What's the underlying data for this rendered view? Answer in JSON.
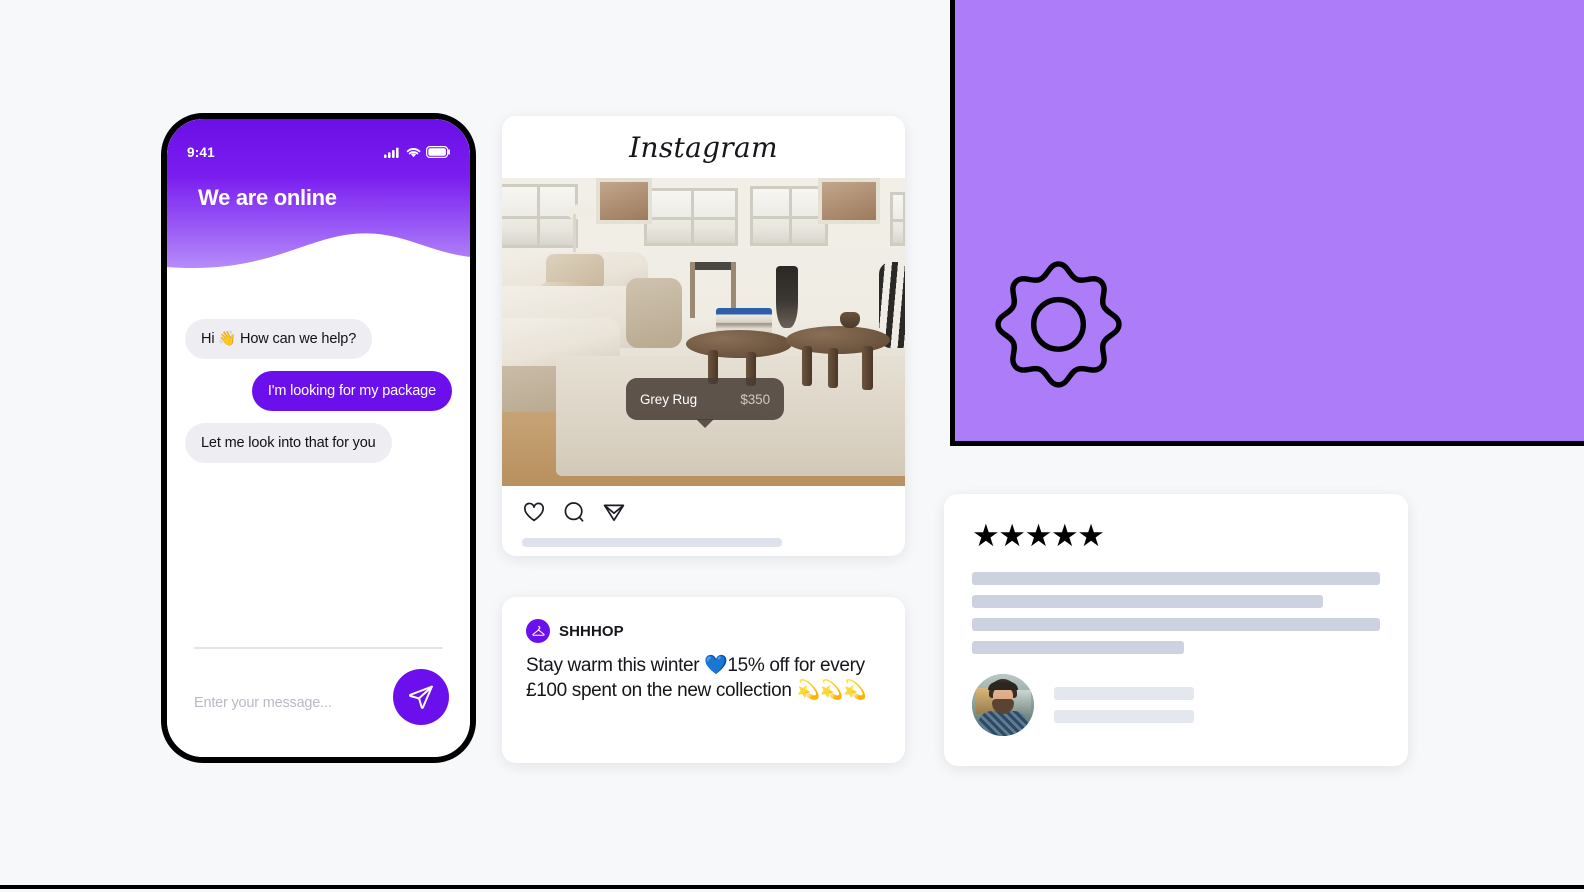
{
  "page": {
    "background_color": "#f6f8fa",
    "accent_purple": "#6b10ec",
    "panel_purple": "#ad7cf8"
  },
  "phone": {
    "status_bar": {
      "time": "9:41",
      "icons": [
        "signal-icon",
        "wifi-icon",
        "battery-icon"
      ]
    },
    "header_title": "We are online",
    "messages": [
      {
        "side": "in",
        "text": "Hi 👋 How can we help?"
      },
      {
        "side": "out",
        "text": "I'm looking for my package"
      },
      {
        "side": "in",
        "text": "Let me look into that for you"
      }
    ],
    "composer": {
      "placeholder": "Enter your message...",
      "value": "",
      "send_icon": "send-paper-plane-icon"
    }
  },
  "instagram_card": {
    "logo_text": "Instagram",
    "photo_alt": "living-room-with-sofa-and-coffee-tables",
    "product_tag": {
      "name": "Grey Rug",
      "price": "$350"
    },
    "actions": [
      "heart-icon",
      "comment-icon",
      "share-icon"
    ],
    "caption_placeholder": true
  },
  "promo_card": {
    "brand_avatar_icon": "clothes-hanger-icon",
    "brand_name": "SHHHOP",
    "text": "Stay warm this winter 💙15% off for every £100 spent on the new collection 💫💫💫"
  },
  "purple_panel": {
    "icon": "gear-icon",
    "background_color": "#ad7cf8",
    "border_color": "#000000"
  },
  "review_card": {
    "stars": "★★★★★",
    "star_count": 5,
    "body_line_widths": [
      "100%",
      "86%",
      "100%",
      "52%"
    ],
    "author": {
      "avatar": "user-photo-avatar",
      "line_count": 2
    }
  }
}
